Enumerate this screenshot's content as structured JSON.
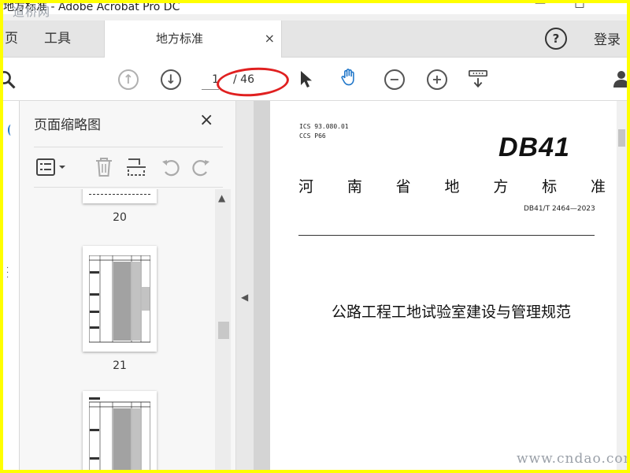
{
  "window": {
    "title": "地方标准 - Adobe Acrobat Pro DC",
    "watermark": "道桥网",
    "minimize": "—",
    "maximize": "□"
  },
  "tabs": {
    "home": "页",
    "tools": "工具",
    "document": "地方标准",
    "document_close": "×",
    "help": "?",
    "login": "登录"
  },
  "toolbar": {
    "current_page": "1",
    "total_pages": "/ 46"
  },
  "thumbnail_panel": {
    "title": "页面缩略图",
    "close": "×",
    "pages": [
      "20",
      "21"
    ]
  },
  "document": {
    "ics": "ICS  93.080.01",
    "ccs": "CCS  P66",
    "logo": "DB41",
    "standard_chars": [
      "河",
      "南",
      "省",
      "地",
      "方",
      "标",
      "准"
    ],
    "number": "DB41/T  2464—2023",
    "title": "公路工程工地试验室建设与管理规范"
  },
  "footer": {
    "watermark": "www.cndao.com"
  }
}
